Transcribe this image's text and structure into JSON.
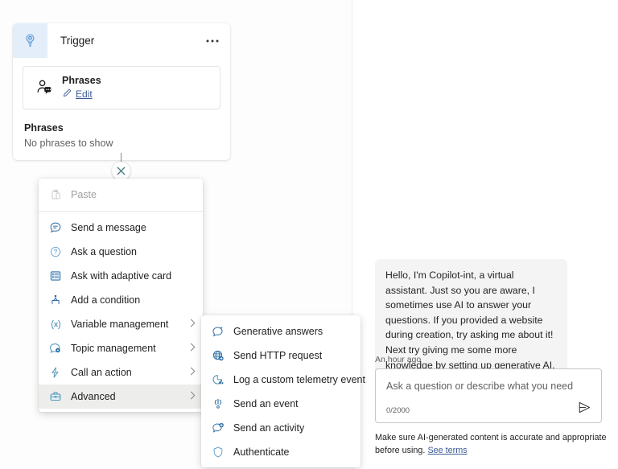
{
  "canvas": {
    "trigger_node": {
      "icon": "trigger-lightbulb-icon",
      "title": "Trigger",
      "more_label": "•••",
      "phrase_card": {
        "icon": "person-phrase-icon",
        "title": "Phrases",
        "edit_icon": "pencil-icon",
        "edit_label": "Edit"
      },
      "phrases_section": {
        "title": "Phrases",
        "empty_text": "No phrases to show"
      }
    },
    "close_button": {
      "icon": "close-x-icon",
      "label": "×"
    }
  },
  "main_menu": {
    "items": [
      {
        "label": "Paste",
        "icon": "paste-icon",
        "disabled": true,
        "submenu": false,
        "highlight": false
      },
      {
        "label": "Send a message",
        "icon": "message-icon",
        "disabled": false,
        "submenu": false,
        "highlight": false
      },
      {
        "label": "Ask a question",
        "icon": "question-icon",
        "disabled": false,
        "submenu": false,
        "highlight": false
      },
      {
        "label": "Ask with adaptive card",
        "icon": "adaptive-card-icon",
        "disabled": false,
        "submenu": false,
        "highlight": false
      },
      {
        "label": "Add a condition",
        "icon": "condition-branch-icon",
        "disabled": false,
        "submenu": false,
        "highlight": false
      },
      {
        "label": "Variable management",
        "icon": "variable-icon",
        "disabled": false,
        "submenu": true,
        "highlight": false
      },
      {
        "label": "Topic management",
        "icon": "topic-gear-icon",
        "disabled": false,
        "submenu": true,
        "highlight": false
      },
      {
        "label": "Call an action",
        "icon": "action-bolt-icon",
        "disabled": false,
        "submenu": true,
        "highlight": false
      },
      {
        "label": "Advanced",
        "icon": "advanced-toolbox-icon",
        "disabled": false,
        "submenu": true,
        "highlight": true
      }
    ]
  },
  "sub_menu": {
    "items": [
      {
        "label": "Generative answers",
        "icon": "generative-answers-icon"
      },
      {
        "label": "Send HTTP request",
        "icon": "globe-http-icon"
      },
      {
        "label": "Log a custom telemetry event",
        "icon": "telemetry-chart-icon"
      },
      {
        "label": "Send an event",
        "icon": "event-icon"
      },
      {
        "label": "Send an activity",
        "icon": "activity-chat-icon"
      },
      {
        "label": "Authenticate",
        "icon": "shield-icon"
      }
    ]
  },
  "chat": {
    "message": "Hello, I'm Copilot-int, a virtual assistant. Just so you are aware, I sometimes use AI to answer your questions. If you provided a website during creation, try asking me about it! Next try giving me some more knowledge by setting up generative AI.",
    "timestamp": "An hour ago",
    "composer": {
      "placeholder": "Ask a question or describe what you need",
      "value": "",
      "counter": "0/2000",
      "send_icon": "send-arrow-icon"
    },
    "disclaimer_text": "Make sure AI-generated content is accurate and appropriate before using. ",
    "disclaimer_link": "See terms"
  },
  "colors": {
    "accent_blue": "#0f6cbd",
    "link_blue": "#3a5a96",
    "trigger_icon_bg": "#e4eefb",
    "bubble_bg": "#f4f4f4",
    "highlight_bg": "#ededeb"
  }
}
